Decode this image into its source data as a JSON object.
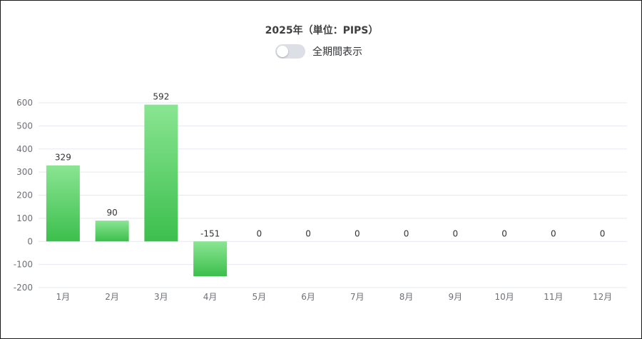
{
  "chart_data": {
    "type": "bar",
    "title": "2025年（単位：PIPS）",
    "categories": [
      "1月",
      "2月",
      "3月",
      "4月",
      "5月",
      "6月",
      "7月",
      "8月",
      "9月",
      "10月",
      "11月",
      "12月"
    ],
    "values": [
      329,
      90,
      592,
      -151,
      0,
      0,
      0,
      0,
      0,
      0,
      0,
      0
    ],
    "ylim": [
      -200,
      600
    ],
    "yticks": [
      600,
      500,
      400,
      300,
      200,
      100,
      0,
      -100,
      -200
    ],
    "grid": true,
    "colors": {
      "bar_top": "#8ae592",
      "bar_bottom": "#3cbf4d",
      "grid": "#e6e9f1",
      "axis_text": "#6e7079"
    }
  },
  "toggle": {
    "label": "全期間表示",
    "on": false
  }
}
